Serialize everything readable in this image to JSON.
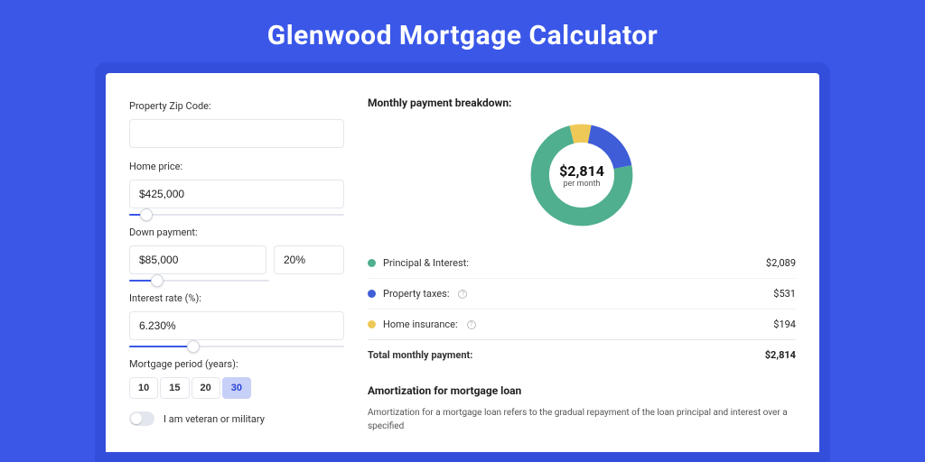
{
  "title": "Glenwood Mortgage Calculator",
  "form": {
    "zip_label": "Property Zip Code:",
    "zip_value": "",
    "home_price_label": "Home price:",
    "home_price_value": "$425,000",
    "home_price_slider_pct": 8,
    "down_payment_label": "Down payment:",
    "down_payment_value": "$85,000",
    "down_payment_pct_value": "20%",
    "down_payment_slider_pct": 20,
    "interest_label": "Interest rate (%):",
    "interest_value": "6.230%",
    "interest_slider_pct": 30,
    "period_label": "Mortgage period (years):",
    "periods": [
      {
        "label": "10",
        "active": false
      },
      {
        "label": "15",
        "active": false
      },
      {
        "label": "20",
        "active": false
      },
      {
        "label": "30",
        "active": true
      }
    ],
    "veteran_label": "I am veteran or military",
    "veteran_on": false
  },
  "breakdown": {
    "title": "Monthly payment breakdown:",
    "center_value": "$2,814",
    "center_sub": "per month",
    "rows": [
      {
        "label": "Principal & Interest:",
        "value": "$2,089",
        "color": "#4faf8e",
        "info": false,
        "num": 2089
      },
      {
        "label": "Property taxes:",
        "value": "$531",
        "color": "#3f5dd6",
        "info": true,
        "num": 531
      },
      {
        "label": "Home insurance:",
        "value": "$194",
        "color": "#efc957",
        "info": true,
        "num": 194
      }
    ],
    "total_label": "Total monthly payment:",
    "total_value": "$2,814"
  },
  "chart_data": {
    "type": "pie",
    "title": "Monthly payment breakdown",
    "series": [
      {
        "name": "Principal & Interest",
        "value": 2089,
        "color": "#4faf8e"
      },
      {
        "name": "Property taxes",
        "value": 531,
        "color": "#3f5dd6"
      },
      {
        "name": "Home insurance",
        "value": 194,
        "color": "#efc957"
      }
    ],
    "total": 2814,
    "center_label": "$2,814 per month"
  },
  "amortization": {
    "title": "Amortization for mortgage loan",
    "text": "Amortization for a mortgage loan refers to the gradual repayment of the loan principal and interest over a specified"
  }
}
